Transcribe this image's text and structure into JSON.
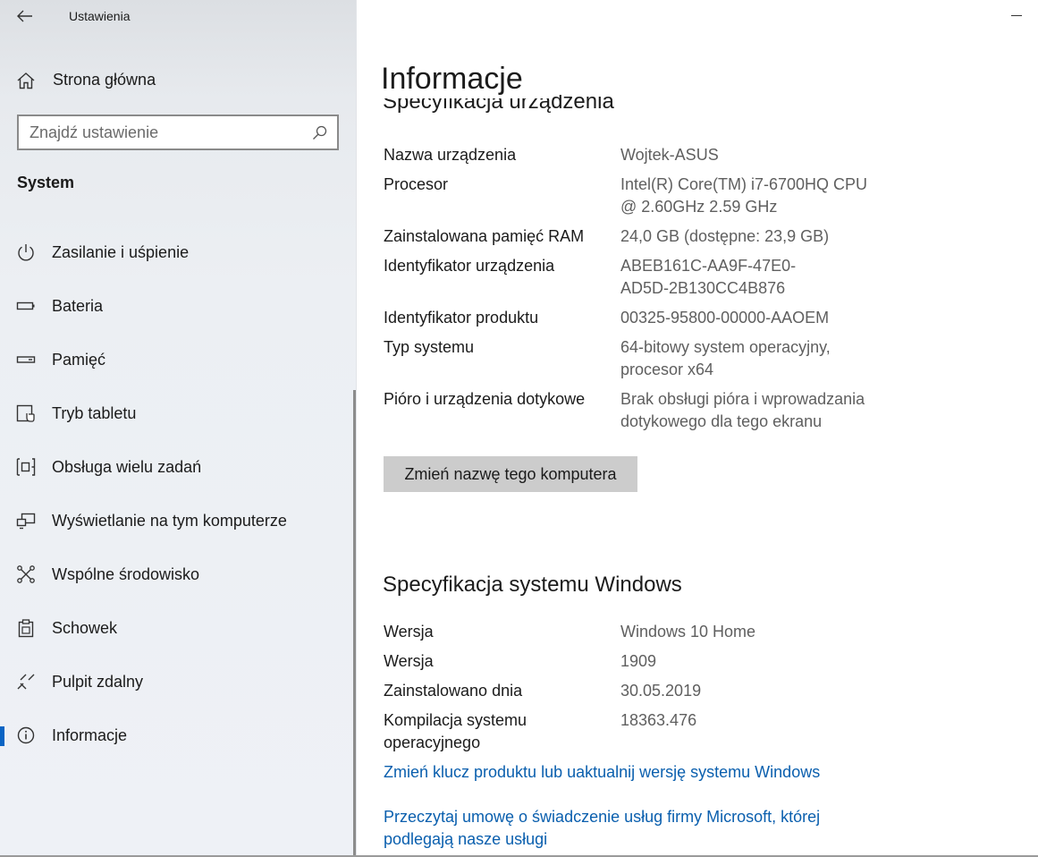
{
  "window": {
    "app_title": "Ustawienia"
  },
  "sidebar": {
    "home_label": "Strona główna",
    "search_placeholder": "Znajdź ustawienie",
    "section_label": "System",
    "items": [
      {
        "label": "Zasilanie i uśpienie",
        "icon": "power-icon"
      },
      {
        "label": "Bateria",
        "icon": "battery-icon"
      },
      {
        "label": "Pamięć",
        "icon": "storage-icon"
      },
      {
        "label": "Tryb tabletu",
        "icon": "tablet-mode-icon"
      },
      {
        "label": "Obsługa wielu zadań",
        "icon": "multitasking-icon"
      },
      {
        "label": "Wyświetlanie na tym komputerze",
        "icon": "projecting-icon"
      },
      {
        "label": "Wspólne środowisko",
        "icon": "shared-experiences-icon"
      },
      {
        "label": "Schowek",
        "icon": "clipboard-icon"
      },
      {
        "label": "Pulpit zdalny",
        "icon": "remote-desktop-icon"
      },
      {
        "label": "Informacje",
        "icon": "info-icon",
        "active": true
      }
    ],
    "accent_color": "#0a64c4"
  },
  "main": {
    "title": "Informacje",
    "device_section_title": "Specyfikacja urządzenia",
    "device_specs": [
      {
        "key": "Nazwa urządzenia",
        "value": "Wojtek-ASUS"
      },
      {
        "key": "Procesor",
        "value": "Intel(R) Core(TM) i7-6700HQ CPU @ 2.60GHz   2.59 GHz"
      },
      {
        "key": "Zainstalowana pamięć RAM",
        "value": "24,0 GB (dostępne: 23,9 GB)"
      },
      {
        "key": "Identyfikator urządzenia",
        "value": "ABEB161C-AA9F-47E0-AD5D-2B130CC4B876"
      },
      {
        "key": "Identyfikator produktu",
        "value": "00325-95800-00000-AAOEM"
      },
      {
        "key": "Typ systemu",
        "value": "64-bitowy system operacyjny, procesor x64"
      },
      {
        "key": "Pióro i urządzenia dotykowe",
        "value": "Brak obsługi pióra i wprowadzania dotykowego dla tego ekranu"
      }
    ],
    "rename_button": "Zmień nazwę tego komputera",
    "windows_section_title": "Specyfikacja systemu Windows",
    "windows_specs": [
      {
        "key": "Wersja",
        "value": "Windows 10 Home"
      },
      {
        "key": "Wersja",
        "value": "1909"
      },
      {
        "key": "Zainstalowano dnia",
        "value": "30.05.2019"
      },
      {
        "key": "Kompilacja systemu operacyjnego",
        "value": "18363.476"
      }
    ],
    "link_product_key": "Zmień klucz produktu lub uaktualnij wersję systemu Windows",
    "link_services_agreement": "Przeczytaj umowę o świadczenie usług firmy Microsoft, której podlegają nasze usługi",
    "link_color": "#0a5fae"
  }
}
